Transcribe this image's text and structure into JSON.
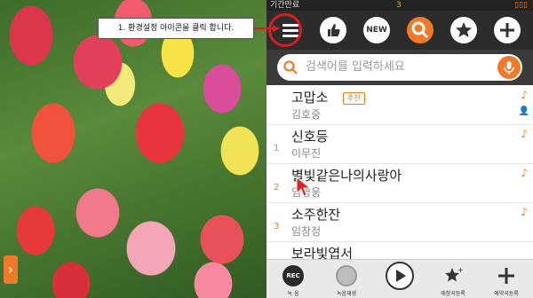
{
  "photo": {
    "nav_arrow": "›"
  },
  "status": {
    "left": "기간만료",
    "mid": "3",
    "right": "▯▯▯"
  },
  "toolbar": {
    "new_label": "NEW"
  },
  "callout": {
    "text": "1. 환경설정 아이콘을 클릭 합니다."
  },
  "search": {
    "placeholder": "검색어를 입력하세요"
  },
  "songs": [
    {
      "num": "",
      "title": "고맙소",
      "artist": "김호중",
      "badge": "추천"
    },
    {
      "num": "1",
      "title": "신호등",
      "artist": "이무진"
    },
    {
      "num": "2",
      "title": "별빛같은나의사랑아",
      "artist": "임영웅"
    },
    {
      "num": "3",
      "title": "소주한잔",
      "artist": "임창정"
    },
    {
      "num": "",
      "title": "보라빛엽서",
      "artist": ""
    }
  ],
  "bottom": {
    "rec_label": "녹 음",
    "playback_label": "녹음재생",
    "fav_label": "애창곡등록",
    "reserve_label": "예약곡등록",
    "rec_text": "REC"
  },
  "colors": {
    "accent": "#f07a2a",
    "toolbar": "#2c2c2c",
    "highlight_ring": "#d81e1e"
  }
}
